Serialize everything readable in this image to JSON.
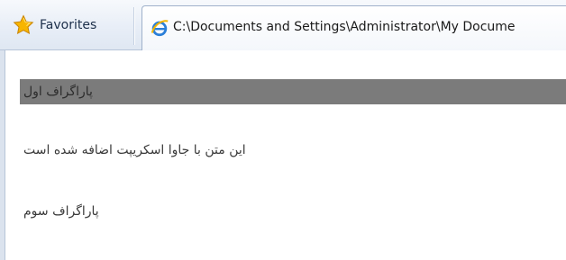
{
  "favorites": {
    "label": "Favorites",
    "icon": "favorites-star-icon"
  },
  "tab": {
    "title": "C:\\Documents and Settings\\Administrator\\My Docume",
    "icon": "internet-explorer-icon"
  },
  "paragraphs": [
    {
      "text": "پاراگراف اول",
      "highlighted": true,
      "background": "#7b7b7b"
    },
    {
      "text": "این متن با جاوا اسکریپت اضافه شده است",
      "highlighted": false
    },
    {
      "text": "پاراگراف سوم",
      "highlighted": false
    }
  ]
}
